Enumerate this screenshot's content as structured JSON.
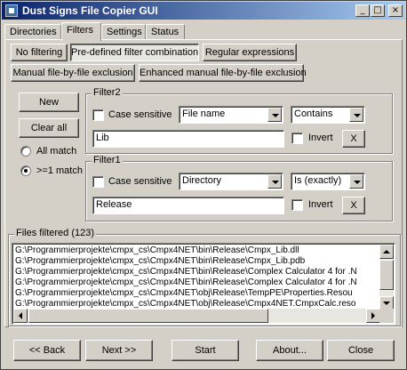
{
  "window": {
    "title": "Dust Signs File Copier GUI",
    "minimize": "_",
    "maximize": "□",
    "close": "×"
  },
  "tabs": [
    {
      "label": "Directories"
    },
    {
      "label": "Filters"
    },
    {
      "label": "Settings"
    },
    {
      "label": "Status"
    }
  ],
  "filter_modes": {
    "no_filtering": "No filtering",
    "predefined": "Pre-defined filter combination",
    "regex": "Regular expressions",
    "manual": "Manual file-by-file exclusion",
    "enhanced_manual": "Enhanced manual file-by-file exclusion"
  },
  "side": {
    "new": "New",
    "clear_all": "Clear all",
    "all_match": "All match",
    "gte1_match": ">=1 match"
  },
  "filter2": {
    "title": "Filter2",
    "case_sensitive": "Case sensitive",
    "field": "File name",
    "operator": "Contains",
    "value": "Lib",
    "invert": "Invert",
    "remove": "X"
  },
  "filter1": {
    "title": "Filter1",
    "case_sensitive": "Case sensitive",
    "field": "Directory",
    "operator": "Is (exactly)",
    "value": "Release",
    "invert": "Invert",
    "remove": "X"
  },
  "files": {
    "title": "Files filtered (123)",
    "rows": [
      "G:\\Programmierprojekte\\cmpx_cs\\Cmpx4NET\\bin\\Release\\Cmpx_Lib.dll",
      "G:\\Programmierprojekte\\cmpx_cs\\Cmpx4NET\\bin\\Release\\Cmpx_Lib.pdb",
      "G:\\Programmierprojekte\\cmpx_cs\\Cmpx4NET\\bin\\Release\\Complex Calculator 4 for .N",
      "G:\\Programmierprojekte\\cmpx_cs\\Cmpx4NET\\bin\\Release\\Complex Calculator 4 for .N",
      "G:\\Programmierprojekte\\cmpx_cs\\Cmpx4NET\\obj\\Release\\TempPE\\Properties.Resou",
      "G:\\Programmierprojekte\\cmpx_cs\\Cmpx4NET\\obj\\Release\\Cmpx4NET.CmpxCalc.reso"
    ]
  },
  "footer": {
    "back": "<< Back",
    "next": "Next >>",
    "start": "Start",
    "about": "About...",
    "close": "Close"
  }
}
